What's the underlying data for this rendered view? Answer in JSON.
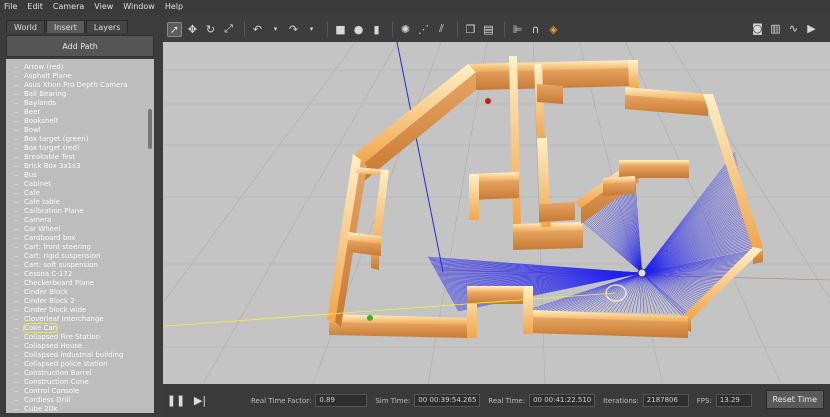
{
  "menu": [
    "File",
    "Edit",
    "Camera",
    "View",
    "Window",
    "Help"
  ],
  "tabs": [
    "World",
    "Insert",
    "Layers"
  ],
  "active_tab": "Insert",
  "add_path_label": "Add Path",
  "models": [
    "Arrow (red)",
    "Asphalt Plane",
    "Asus Xtion Pro Depth Camera",
    "Ball Bearing",
    "Baylands",
    "Beer",
    "Bookshelf",
    "Bowl",
    "Box target (green)",
    "Box target (red)",
    "Breakable Test",
    "Brick Box 3x1x3",
    "Bus",
    "Cabinet",
    "Cafe",
    "Cafe table",
    "Calibration Plane",
    "Camera",
    "Car Wheel",
    "Cardboard box",
    "Cart: front steering",
    "Cart: rigid suspension",
    "Cart: soft suspension",
    "Cessna C-172",
    "Checkerboard Plane",
    "Cinder Block",
    "Cinder Block 2",
    "Cinder block wide",
    "Cloverleaf Interchange",
    "Coke Can",
    "Collapsed Fire Station",
    "Collapsed House",
    "Collapsed industrial building",
    "Collapsed police station",
    "Construction Barrel",
    "Construction Cone",
    "Control Console",
    "Cordless Drill",
    "Cube 20k"
  ],
  "selected_model": "Coke Can",
  "bottom": {
    "rtf_label": "Real Time Factor:",
    "rtf_value": "0.89",
    "sim_label": "Sim Time:",
    "sim_value": "00 00:39:54.265",
    "real_label": "Real Time:",
    "real_value": "00 00:41:22.510",
    "iter_label": "Iterations:",
    "iter_value": "2187806",
    "fps_label": "FPS:",
    "fps_value": "13.29",
    "reset_label": "Reset Time"
  },
  "colors": {
    "wall": "#e8a046",
    "laser": "#2222ee",
    "ground": "#c4c4c4",
    "grid": "#aaaaaa",
    "annotation": "#f2f23a"
  },
  "icons": {
    "select": "cursor-icon",
    "translate": "move-icon",
    "rotate": "rotate-icon",
    "scale": "scale-icon",
    "undo": "undo-icon",
    "redo": "redo-icon",
    "box": "box-shape-icon",
    "sphere": "sphere-shape-icon",
    "cylinder": "cylinder-shape-icon",
    "point_light": "point-light-icon",
    "spot_light": "spot-light-icon",
    "dir_light": "directional-light-icon",
    "copy": "copy-icon",
    "paste": "paste-icon",
    "align": "align-icon",
    "snap": "snap-icon",
    "change_view": "view-angle-icon",
    "screenshot": "camera-icon",
    "log": "log-icon",
    "plot": "plot-icon",
    "video": "video-icon",
    "play": "play-icon",
    "step": "step-icon"
  }
}
